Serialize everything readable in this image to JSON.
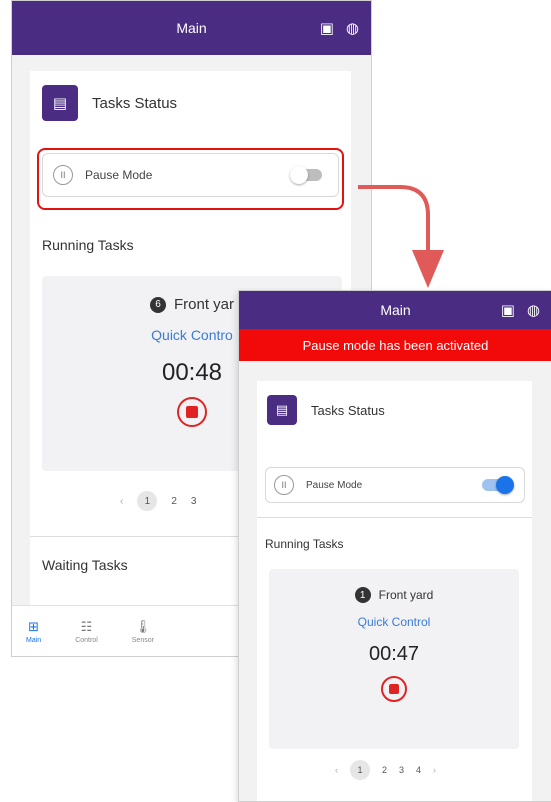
{
  "before": {
    "appbar": {
      "title": "Main",
      "icon_1": "image-plus-icon",
      "icon_2": "globe-icon"
    },
    "card": {
      "title": "Tasks Status",
      "pause_label": "Pause Mode",
      "pause_enabled": false,
      "running_title": "Running Tasks",
      "task": {
        "number": "6",
        "zone": "Front yar",
        "link": "Quick Contro",
        "timer": "00:48"
      },
      "pager": {
        "prev": "‹",
        "pages": [
          "1",
          "2",
          "3"
        ],
        "active_page": "1"
      },
      "waiting_title": "Waiting Tasks"
    },
    "bottom_nav": [
      {
        "label": "Main",
        "icon": "grid-icon",
        "active": true
      },
      {
        "label": "Control",
        "icon": "control-icon",
        "active": false
      },
      {
        "label": "Sensor",
        "icon": "thermometer-icon",
        "active": false
      }
    ]
  },
  "after": {
    "appbar": {
      "title": "Main",
      "icon_1": "image-plus-icon",
      "icon_2": "globe-icon"
    },
    "banner": "Pause mode has been activated",
    "card": {
      "title": "Tasks Status",
      "pause_label": "Pause Mode",
      "pause_enabled": true,
      "running_title": "Running Tasks",
      "task": {
        "number": "1",
        "zone": "Front yard",
        "link": "Quick Control",
        "timer": "00:47"
      },
      "pager": {
        "prev": "‹",
        "pages": [
          "1",
          "2",
          "3",
          "4"
        ],
        "next": "›",
        "active_page": "1"
      }
    }
  },
  "colors": {
    "appbar": "#4a2d82",
    "banner": "#f20a0a",
    "highlight": "#e31212",
    "arrow": "#e05a5a",
    "link": "#3a7bd5",
    "stop": "#e02424",
    "toggle_on": "#1a73e8"
  }
}
